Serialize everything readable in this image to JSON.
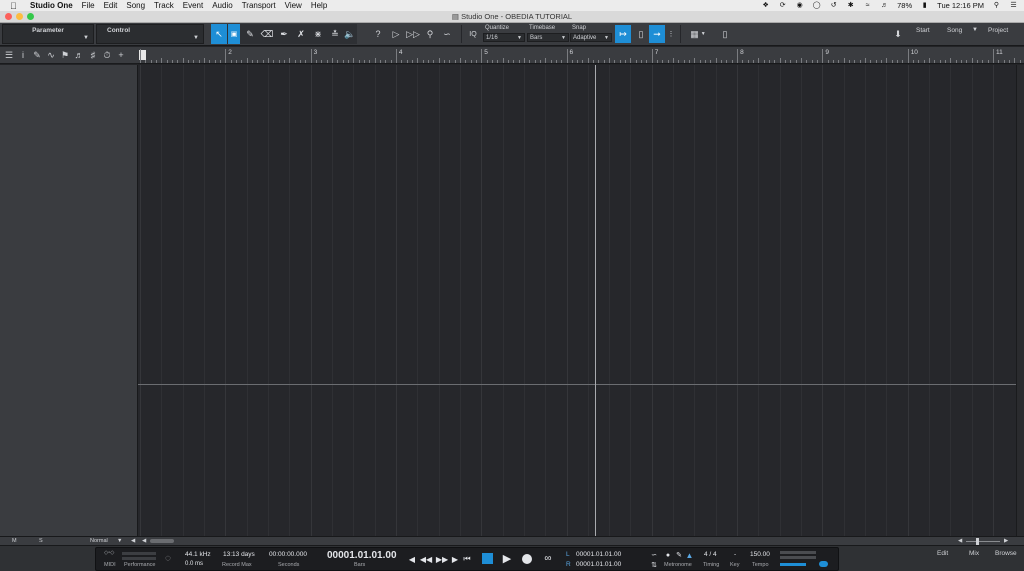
{
  "menubar": {
    "app_name": "Studio One",
    "items": [
      "File",
      "Edit",
      "Song",
      "Track",
      "Event",
      "Audio",
      "Transport",
      "View",
      "Help"
    ],
    "battery": "78%",
    "clock": "Tue 12:16 PM"
  },
  "window": {
    "title": "Studio One - OBEDIA TUTORIAL"
  },
  "toolbar": {
    "parameter_label": "Parameter",
    "control_label": "Control",
    "quantize": {
      "label": "Quantize",
      "value": "1/16"
    },
    "timebase": {
      "label": "Timebase",
      "value": "Bars"
    },
    "snap": {
      "label": "Snap",
      "value": "Adaptive"
    },
    "pages": {
      "start": "Start",
      "song": "Song",
      "project": "Project"
    }
  },
  "ruler": {
    "bars": [
      "2",
      "3",
      "4",
      "5",
      "6",
      "7",
      "8",
      "9",
      "10",
      "11"
    ]
  },
  "bottombar": {
    "mute": "M",
    "solo": "S",
    "view_mode": "Normal"
  },
  "transport": {
    "midi_label": "MIDI",
    "performance_label": "Performance",
    "sample_rate": "44.1 kHz",
    "latency": "0.0 ms",
    "record_max_value": "13:13 days",
    "record_max_label": "Record Max",
    "seconds_value": "00:00:00.000",
    "seconds_label": "Seconds",
    "bars_value": "00001.01.01.00",
    "bars_label": "Bars",
    "loop_left_label": "L",
    "loop_left": "00001.01.01.00",
    "loop_right_label": "R",
    "loop_right": "00001.01.01.00",
    "metronome_label": "Metronome",
    "time_signature": "4 / 4",
    "timing_label": "Timing",
    "key_value": "-",
    "key_label": "Key",
    "tempo_value": "150.00",
    "tempo_label": "Tempo"
  },
  "right_pages": {
    "edit": "Edit",
    "mix": "Mix",
    "browse": "Browse"
  }
}
